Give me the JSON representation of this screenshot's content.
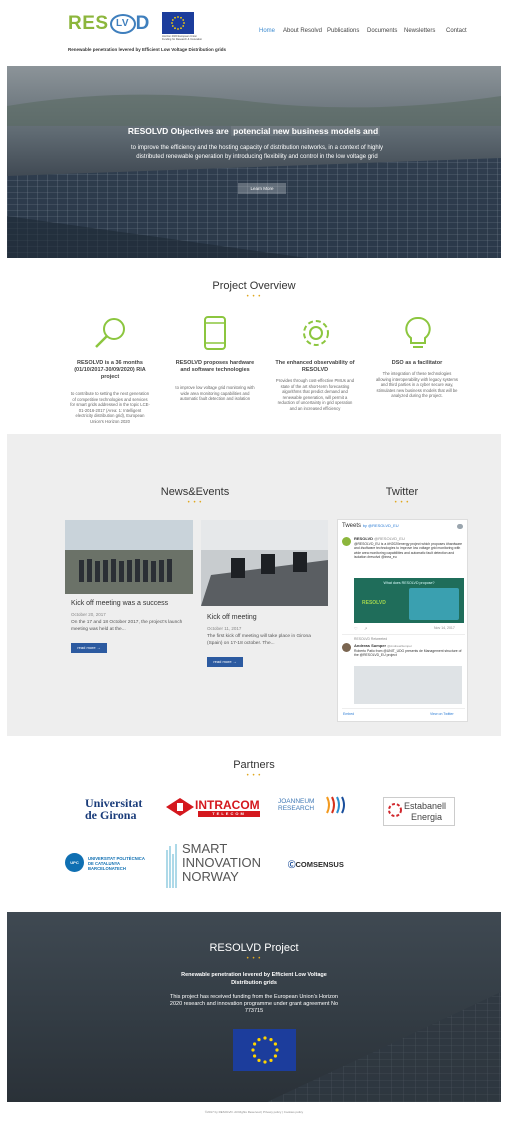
{
  "header": {
    "logo_text": "RES",
    "logo_lv": "LV",
    "logo_d": "D",
    "tagline": "Renewable penetration levered by Efficient Low Voltage Distribution grids",
    "eu_caption": "Horizon 2020 European Union Funding for Research & Innovation",
    "nav": [
      "Home",
      "About Resolvd",
      "Publications",
      "Documents",
      "Newsletters",
      "Contact"
    ]
  },
  "hero": {
    "title_a": "RESOLVD Objectives are",
    "title_b": "potencial new business models and",
    "subtitle": "to improve the efficiency and the hosting capacity of distribution networks, in a context of highly distributed renewable generation by introducing flexibility and control in the low voltage grid",
    "button": "Learn More"
  },
  "overview": {
    "title": "Project Overview",
    "dots": "• • •",
    "items": [
      {
        "icon": "magnifier-icon",
        "title": "RESOLVD is a 36 months (01/10/2017-30/09/2020) RIA project",
        "text": "to contribute to setting the next generation of competitive technologies and services for smart grids addressed in the topic LCE-01-2016-2017 (Area: 1: Intelligent electricity distribution grid), European Union's Horizon 2020"
      },
      {
        "icon": "tablet-icon",
        "title": "RESOLVD proposes hardware and software technologies",
        "text": "to improve low voltage grid monitoring with wide area monitoring capabilities and automatic fault detection and isolation"
      },
      {
        "icon": "gear-icon",
        "title": "The enhanced observability of RESOLVD",
        "text": "Provides through cost-effective PMUs and state of the art short-term forecasting algorithms that predict demand and renewable generation, will permit a reduction of uncertainty in grid operation and an increased efficiency"
      },
      {
        "icon": "lightbulb-icon",
        "title": "DSO as a facilitator",
        "text": "The integration of these technologies allowing interoperability with legacy systems and third parties in a cyber secure way, stimulates new business models that will be analyzed during the project."
      }
    ]
  },
  "news": {
    "title": "News&Events",
    "dots": "• • •",
    "posts": [
      {
        "title": "Kick off meeting was a success",
        "date": "October 20, 2017",
        "excerpt": "On the 17 and 18 October 2017, the project's launch meeting was held at the...",
        "button": "read more →"
      },
      {
        "title": "Kick off meeting",
        "date": "October 11, 2017",
        "excerpt": "The first kick off meeting will take place in Girona (Spain) on 17-18 october. The...",
        "button": "read more →"
      }
    ]
  },
  "twitter": {
    "title": "Twitter",
    "dots": "• • •",
    "header": "Tweets",
    "handle": "by @RESOLVD_EU",
    "tweet1_name": "RESOLVD",
    "tweet1_handle": "@RESOLVD_EU",
    "tweet1_text": "@RESOLVD_EU is a #H2020energy project which proposes #hardware and #software technologies to improve low voltage grid monitoring with wide area monitoring capabilities and automatic fault detection and isolation #resolvd @inea_eu",
    "card_caption": "What does RESOLVD propose?",
    "tweet1_date": "Nov 14, 2017",
    "retweet_label": "RESOLVD Retweeted",
    "tweet2_name": "Andreas Sumper",
    "tweet2_handle": "@AndreasSumper",
    "tweet2_text": "Roberto Patio from @UNIT_UDG presents de Management structure of the @RESOLVD_EU project",
    "embed": "Embed",
    "view_on": "View on Twitter"
  },
  "partners": {
    "title": "Partners",
    "dots": "• • •",
    "udg_1": "Universitat",
    "udg_2": "de Girona",
    "intracom": "INTRACOM",
    "intracom_sub": "TELECOM",
    "joanneum_1": "JOANNEUM",
    "joanneum_2": "RESEARCH",
    "estabanell_1": "Estabanell",
    "estabanell_2": "Energia",
    "upc_1": "UNIVERSITAT POLITÈCNICA",
    "upc_2": "DE CATALUNYA",
    "upc_3": "BARCELONATECH",
    "upc_logo": "UPC",
    "sin_1": "SMART",
    "sin_2": "INNOVATION",
    "sin_3": "NORWAY",
    "comsensus": "COMSENSUS"
  },
  "footer": {
    "title": "RESOLVD Project",
    "dots": "• • •",
    "subtitle": "Renewable penetration levered by Efficient Low Voltage Distribution grids",
    "text": "This project has received funding from the European Union's Horizon 2020 research and innovation programme under grant agreement No 773715",
    "copyright": "©2017 by RESOLVD. All Rights Reserved | Privacy policy | Cookies policy"
  }
}
